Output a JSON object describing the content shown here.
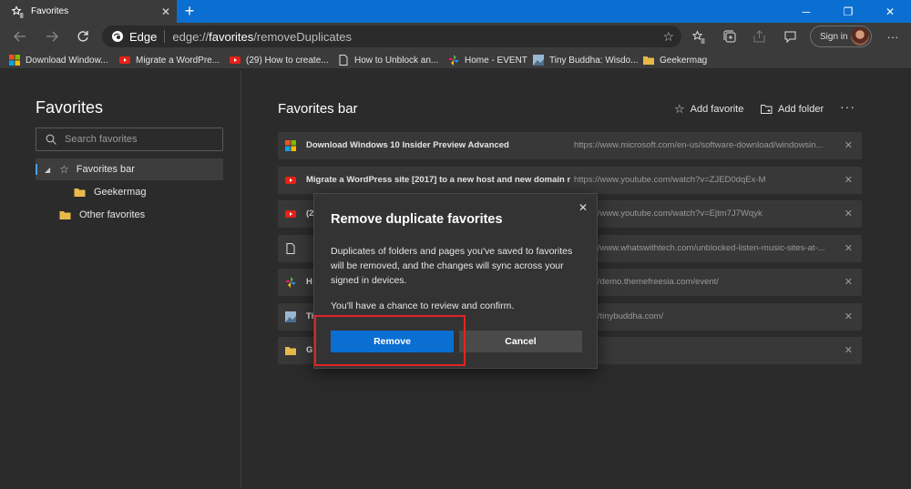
{
  "tab": {
    "title": "Favorites",
    "close": "✕",
    "new_tab": "+"
  },
  "window": {
    "min": "─",
    "max": "❐",
    "close": "✕"
  },
  "address": {
    "brand": "Edge",
    "url_prefix": "edge://",
    "url_host": "favorites",
    "url_path": "/removeDuplicates"
  },
  "signin": {
    "label": "Sign in"
  },
  "favorites_bar": [
    {
      "label": "Download Window...",
      "icon": "windows-icon"
    },
    {
      "label": "Migrate a WordPre...",
      "icon": "youtube-icon"
    },
    {
      "label": "(29) How to create...",
      "icon": "youtube-icon"
    },
    {
      "label": "How to Unblock an...",
      "icon": "page-icon"
    },
    {
      "label": "Home - EVENT",
      "icon": "pinwheel-icon"
    },
    {
      "label": "Tiny Buddha: Wisdo...",
      "icon": "image-icon"
    },
    {
      "label": "Geekermag",
      "icon": "folder-icon"
    }
  ],
  "left": {
    "title": "Favorites",
    "search_placeholder": "Search favorites",
    "tree": {
      "favorites_bar": "Favorites bar",
      "geekermag": "Geekermag",
      "other": "Other favorites"
    }
  },
  "right": {
    "title": "Favorites bar",
    "add_favorite": "Add favorite",
    "add_folder": "Add folder",
    "more": "···",
    "rows": [
      {
        "name": "Download Windows 10 Insider Preview Advanced",
        "url": "https://www.microsoft.com/en-us/software-download/windowsin...",
        "icon": "windows-icon"
      },
      {
        "name": "Migrate a WordPress site [2017] to a new host and new domain m...",
        "url": "https://www.youtube.com/watch?v=ZJED0dqEx-M",
        "icon": "youtube-icon"
      },
      {
        "name": "(2",
        "url": "https://www.youtube.com/watch?v=Ejtm7J7Wqyk",
        "icon": "youtube-icon"
      },
      {
        "name": "",
        "url": "https://www.whatswithtech.com/unblocked-listen-music-sites-at-...",
        "icon": "page-icon"
      },
      {
        "name": "H",
        "url": "https://demo.themefreesia.com/event/",
        "icon": "pinwheel-icon"
      },
      {
        "name": "Ti",
        "url": "https://tinybuddha.com/",
        "icon": "image-icon"
      },
      {
        "name": "G",
        "url": "",
        "icon": "folder-icon"
      }
    ]
  },
  "dialog": {
    "title": "Remove duplicate favorites",
    "body": "Duplicates of folders and pages you've saved to favorites will be removed, and the changes will sync across your signed in devices.",
    "note": "You'll have a chance to review and confirm.",
    "remove": "Remove",
    "cancel": "Cancel",
    "close": "✕"
  },
  "colors": {
    "accent": "#0a6fd1",
    "highlight": "#e02424"
  }
}
